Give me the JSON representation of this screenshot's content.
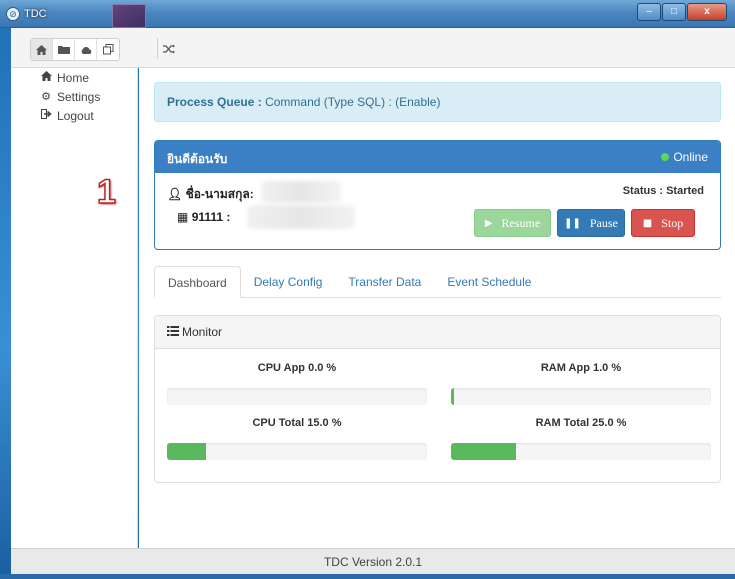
{
  "window": {
    "title": "TDC",
    "logo_glyph": "⊘",
    "controls": {
      "minimize": "–",
      "maximize": "□",
      "close": "x"
    }
  },
  "toolbar": {
    "icons": [
      "home-icon",
      "folder-icon",
      "cloud-icon",
      "copy-icon",
      "shuffle-icon"
    ]
  },
  "sidebar": {
    "items": [
      {
        "label": "Home",
        "icon": "home-icon"
      },
      {
        "label": "Settings",
        "icon": "gear-icon"
      },
      {
        "label": "Logout",
        "icon": "logout-icon"
      }
    ],
    "annotation": "1"
  },
  "queue": {
    "label": "Process Queue :",
    "value": "Command (Type SQL) : (Enable)"
  },
  "welcome": {
    "title": "ยินดีต้อนรับ",
    "online_label": "Online",
    "name_label": "ชื่อ-นามสกุล:",
    "id_label": "91111 :",
    "status": "Status : Started",
    "buttons": {
      "resume": "Resume",
      "pause": "Pause",
      "stop": "Stop"
    }
  },
  "tabs": [
    {
      "label": "Dashboard",
      "active": true
    },
    {
      "label": "Delay Config",
      "active": false
    },
    {
      "label": "Transfer Data",
      "active": false
    },
    {
      "label": "Event Schedule",
      "active": false
    }
  ],
  "monitor": {
    "title": "Monitor",
    "metrics": [
      {
        "label": "CPU App 0.0 %",
        "percent": 0.0
      },
      {
        "label": "RAM App 1.0 %",
        "percent": 1.0
      },
      {
        "label": "CPU Total 15.0 %",
        "percent": 15.0
      },
      {
        "label": "RAM Total 25.0 %",
        "percent": 25.0
      }
    ]
  },
  "footer": {
    "version": "TDC Version 2.0.1"
  },
  "colors": {
    "primary": "#337ab7",
    "success": "#5cb85c",
    "danger": "#d9534f",
    "info_bg": "#d9edf7",
    "online": "#5cd65c"
  }
}
